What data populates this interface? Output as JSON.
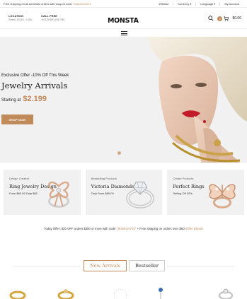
{
  "topbar": {
    "promo_prefix": "Free shipping on all domestic orders with coupon code ",
    "promo_code": "\"Watches2021\"",
    "wishlist": "Wishlist",
    "currency": "Currency ▾",
    "language": "Language ▾",
    "account": "My Account"
  },
  "header": {
    "location_title": "LOCATION",
    "location_value": "Street 10245 - USA",
    "call_title": "CALL FREE",
    "call_value": "+(012) 800 456 789",
    "logo": "MONSTA",
    "cart_count": "0",
    "cart_total": "$0.00"
  },
  "hero": {
    "subtitle": "Exclusive Offer -10% Off This Week",
    "title": "Jewelry Arrivals",
    "starting_label": "Starting at",
    "price": "$2.199",
    "button": "SHOP NOW"
  },
  "banners": [
    {
      "category": "Design Creative",
      "name": "Ring Jewelry Design",
      "price": "From $60.99 Only $80"
    },
    {
      "category": "Bestselling Products",
      "name": "Victoria Diamonds",
      "price": "Only From $89.00"
    },
    {
      "category": "Ornate Products",
      "name": "Perfect Rings",
      "price": "Selling Off 30%"
    }
  ],
  "offer": {
    "text_before": "Today Offer: $20 OFF orders $300 or more with code ",
    "code": "\"JEWELRY01\"",
    "text_after": " + Free shipping on orders over $60! ",
    "link": "Offer Details"
  },
  "tabs": [
    "New Arrivals",
    "Bestseller"
  ],
  "colors": {
    "accent": "#c08a5b",
    "hero_bg": "#f1f1f1"
  }
}
